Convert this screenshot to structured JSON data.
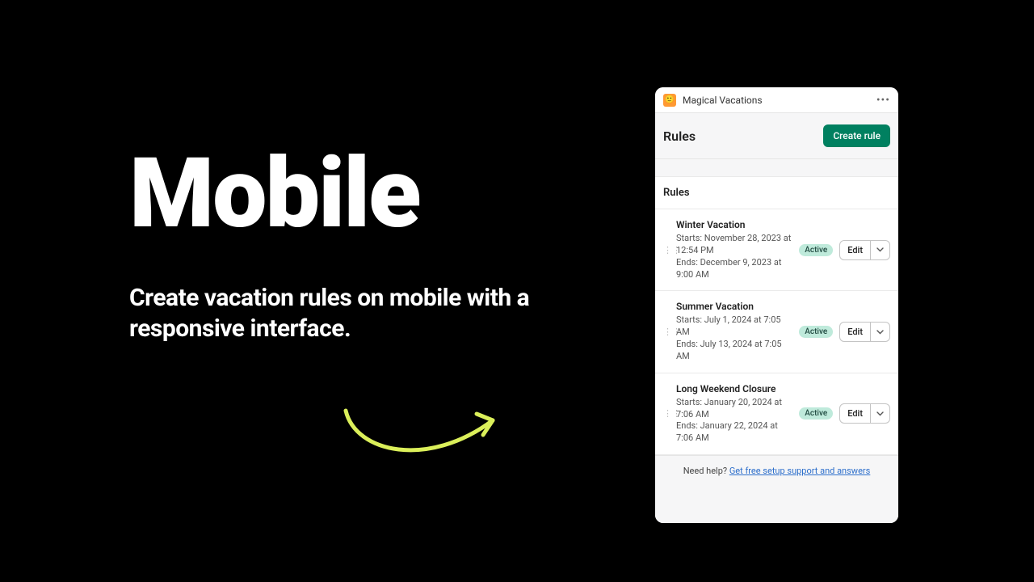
{
  "hero": {
    "title": "Mobile",
    "subtitle": "Create vacation rules on mobile with a responsive interface."
  },
  "app": {
    "name": "Magical Vacations",
    "icon_name": "smiley-icon"
  },
  "page": {
    "title": "Rules",
    "create_button": "Create rule"
  },
  "card": {
    "header": "Rules"
  },
  "rules": [
    {
      "title": "Winter Vacation",
      "starts": "Starts: November 28, 2023 at 12:54 PM",
      "ends": "Ends: December 9, 2023 at 9:00 AM",
      "status": "Active",
      "edit": "Edit"
    },
    {
      "title": "Summer Vacation",
      "starts": "Starts: July 1, 2024 at 7:05 AM",
      "ends": "Ends: July 13, 2024 at 7:05 AM",
      "status": "Active",
      "edit": "Edit"
    },
    {
      "title": "Long Weekend Closure",
      "starts": "Starts: January 20, 2024 at 7:06 AM",
      "ends": "Ends: January 22, 2024 at 7:06 AM",
      "status": "Active",
      "edit": "Edit"
    }
  ],
  "footer": {
    "prefix": "Need help? ",
    "link": "Get free setup support and answers"
  },
  "colors": {
    "accent": "#008060",
    "badge_bg": "#bfeadb",
    "arrow": "#dbef5a"
  }
}
